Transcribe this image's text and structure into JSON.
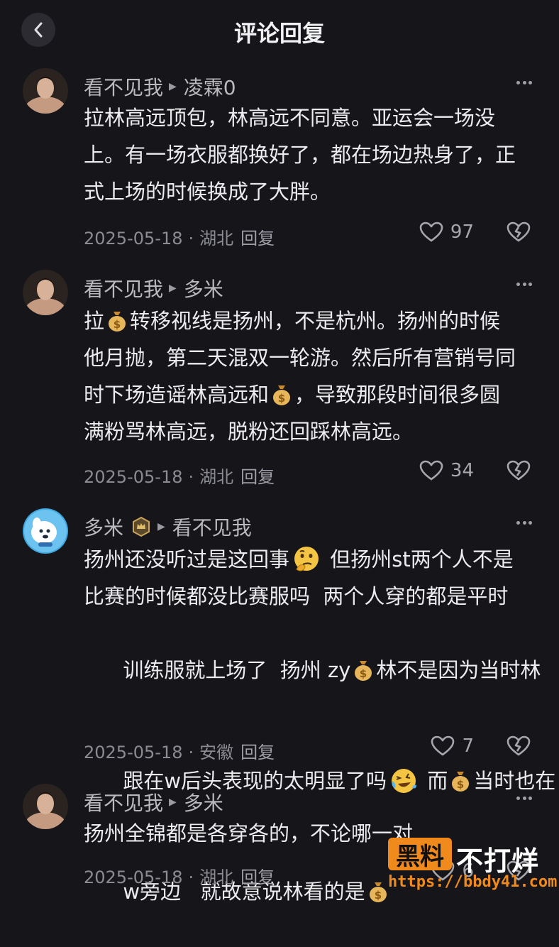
{
  "header": {
    "title": "评论回复"
  },
  "comments": [
    {
      "user": "看不见我",
      "reply_to": "凌霖0",
      "lines": [
        "拉林高远顶包，林高远不同意。亚运会一场没",
        "上。有一场衣服都换好了，都在场边热身了，正",
        "式上场的时候换成了大胖。"
      ],
      "date": "2025-05-18",
      "location": "湖北",
      "reply_label": "回复",
      "likes": "97"
    },
    {
      "user": "看不见我",
      "reply_to": "多米",
      "line1_a": "拉",
      "line1_b": "转移视线是扬州，不是杭州。扬州的时候",
      "line2": "他月抛，第二天混双一轮游。然后所有营销号同",
      "line3_a": "时下场造谣林高远和",
      "line3_b": "，导致那段时间很多圆",
      "line4": "满粉骂林高远，脱粉还回踩林高远。",
      "date": "2025-05-18",
      "location": "湖北",
      "reply_label": "回复",
      "likes": "34"
    },
    {
      "user": "多米",
      "reply_to": "看不见我",
      "line1_a": "扬州还没听过是这回事",
      "line1_b": " 但扬州st两个人不是",
      "line2": "比赛的时候都没比赛服吗  两个人穿的都是平时",
      "line3_a": "训练服就上场了  扬州 zy",
      "line3_b": "林不是因为当时林",
      "line4_a": "跟在w后头表现的太明显了吗",
      "line4_b": " 而",
      "line4_c": "当时也在",
      "line5_a": "w旁边   就故意说林看的是",
      "date": "2025-05-18",
      "location": "安徽",
      "reply_label": "回复",
      "likes": "7"
    },
    {
      "user": "看不见我",
      "reply_to": "多米",
      "line1": "扬州全锦都是各穿各的，不论哪一对",
      "date": "2025-05-18",
      "location": "湖北",
      "reply_label": "回复",
      "likes": "6"
    }
  ],
  "watermark": {
    "brand": "黑料",
    "slogan": "不打烊",
    "url": "https://bbdy41.com"
  },
  "colors": {
    "background": "#16161a",
    "text": "#ececee",
    "muted": "#8b8b92",
    "watermark_orange": "#f08a1c"
  },
  "icons": [
    "back-arrow-icon",
    "more-dots-icon",
    "heart-icon",
    "broken-heart-icon",
    "money-bag-emoji",
    "thinking-face-emoji",
    "crying-laughing-emoji",
    "fan-badge-icon"
  ]
}
